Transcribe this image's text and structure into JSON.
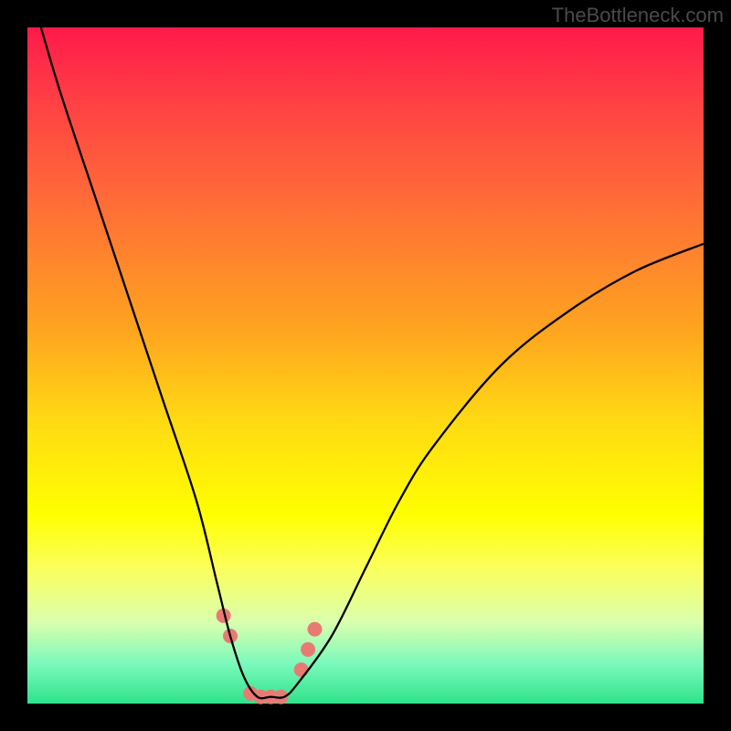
{
  "watermark": "TheBottleneck.com",
  "chart_data": {
    "type": "line",
    "title": "",
    "xlabel": "",
    "ylabel": "",
    "xlim": [
      0,
      100
    ],
    "ylim": [
      0,
      100
    ],
    "series": [
      {
        "name": "bottleneck-curve",
        "x": [
          2,
          5,
          10,
          15,
          20,
          25,
          28,
          30,
          32,
          34,
          36,
          38,
          40,
          45,
          50,
          55,
          60,
          70,
          80,
          90,
          100
        ],
        "y": [
          100,
          90,
          75,
          60,
          45,
          30,
          18,
          10,
          4,
          1,
          1,
          1,
          3,
          10,
          20,
          30,
          38,
          50,
          58,
          64,
          68
        ]
      }
    ],
    "markers": {
      "name": "highlight-dots",
      "x": [
        29,
        30,
        33,
        34.5,
        36,
        37.5,
        40.5,
        41.5,
        42.5
      ],
      "y": [
        13,
        10,
        1.5,
        1,
        1,
        1,
        5,
        8,
        11
      ],
      "color": "#e77b74",
      "radius": 8
    },
    "gradient_stops": [
      {
        "pos": 0,
        "color": "#ff194a"
      },
      {
        "pos": 25,
        "color": "#ff6a38"
      },
      {
        "pos": 58,
        "color": "#ffd914"
      },
      {
        "pos": 80,
        "color": "#fbff5c"
      },
      {
        "pos": 100,
        "color": "#2fe38c"
      }
    ]
  }
}
